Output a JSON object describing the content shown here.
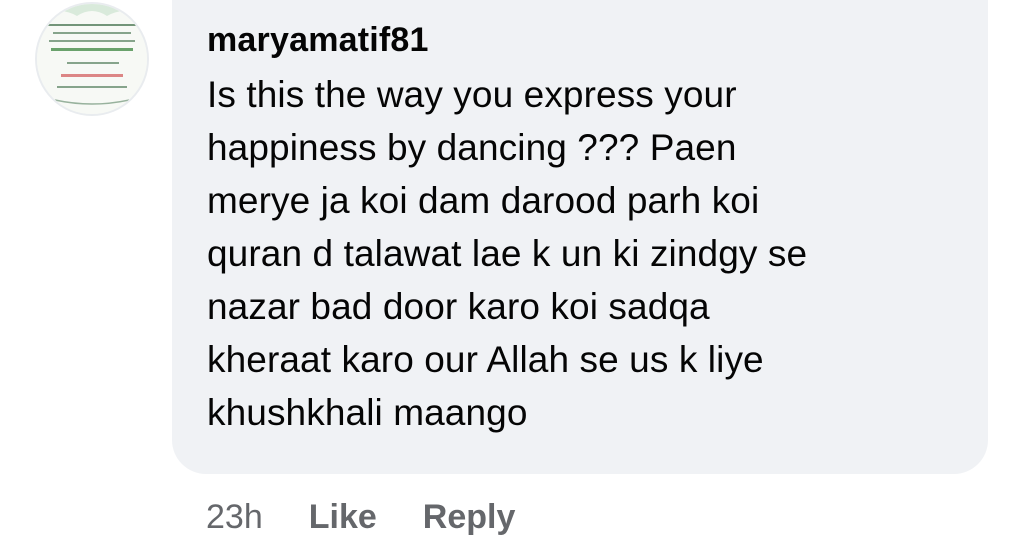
{
  "comment": {
    "username": "maryamatif81",
    "text": "Is this the way you express your\nhappiness by dancing ??? Paen\nmerye ja koi dam darood parh koi\nquran d talawat lae k un ki zindgy se\nnazar bad door karo koi sadqa\nkheraat karo our Allah se us k liye\nkhushkhali maango",
    "avatar_icon": "calligraphy-avatar-icon",
    "colors": {
      "bubble_background": "#f0f2f5",
      "text": "#050505",
      "meta_text": "#65676b"
    }
  },
  "actions": {
    "time": "23h",
    "like_label": "Like",
    "reply_label": "Reply"
  }
}
